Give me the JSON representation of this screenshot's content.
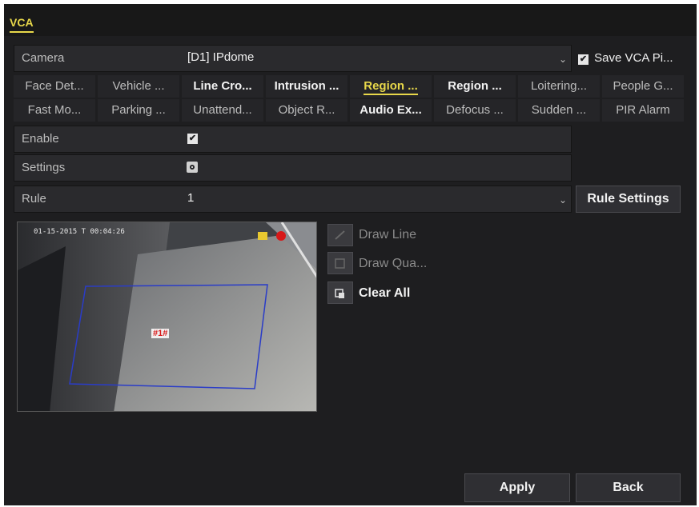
{
  "header": {
    "tab_label": "VCA"
  },
  "camera": {
    "label": "Camera",
    "value": "[D1] IPdome",
    "save_label": "Save VCA Pi..."
  },
  "tabs_row1": [
    "Face Det...",
    "Vehicle ...",
    "Line Cro...",
    "Intrusion ...",
    "Region ...",
    "Region ...",
    "Loitering...",
    "People G..."
  ],
  "tabs_row2": [
    "Fast Mo...",
    "Parking ...",
    "Unattend...",
    "Object R...",
    "Audio Ex...",
    "Defocus ...",
    "Sudden ...",
    "PIR Alarm"
  ],
  "enable": {
    "label": "Enable",
    "checked": true
  },
  "settings": {
    "label": "Settings"
  },
  "rule": {
    "label": "Rule",
    "value": "1",
    "settings_button": "Rule Settings"
  },
  "preview": {
    "timestamp": "01-15-2015 T 00:04:26",
    "region_tag": "#1#"
  },
  "draw": {
    "line_label": "Draw Line",
    "quad_label": "Draw Qua...",
    "clear_label": "Clear All"
  },
  "footer": {
    "apply_label": "Apply",
    "back_label": "Back"
  },
  "colors": {
    "accent": "#e8d84a",
    "region_outline": "#2a3cc8",
    "tag_red": "#d81818"
  }
}
